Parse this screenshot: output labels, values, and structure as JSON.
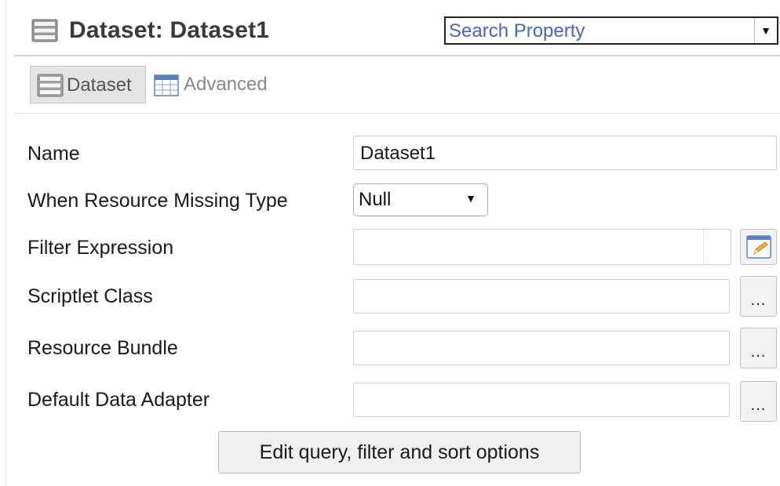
{
  "header": {
    "title": "Dataset: Dataset1",
    "title_icon": "dataset-icon"
  },
  "search": {
    "placeholder": "Search Property",
    "arrow_icon": "triangle-down-icon"
  },
  "tabs": [
    {
      "label": "Dataset",
      "icon": "dataset-icon",
      "selected": true
    },
    {
      "label": "Advanced",
      "icon": "table-icon",
      "selected": false
    }
  ],
  "properties": {
    "name": {
      "label": "Name",
      "value": "Dataset1"
    },
    "missing_type": {
      "label": "When Resource Missing Type",
      "value": "Null"
    },
    "filter_expression": {
      "label": "Filter Expression",
      "value": "",
      "button_icon": "expression-editor-icon"
    },
    "scriptlet_class": {
      "label": "Scriptlet Class",
      "value": "",
      "button_label": "..."
    },
    "resource_bundle": {
      "label": "Resource Bundle",
      "value": "",
      "button_label": "..."
    },
    "default_adapter": {
      "label": "Default Data Adapter",
      "value": "",
      "button_label": "..."
    }
  },
  "actions": {
    "edit_query_label": "Edit query, filter and sort options"
  },
  "colors": {
    "search_text": "#4a67b0",
    "header_rule": "#c8d9ee",
    "tab_selected_bg": "#e4e4e4"
  }
}
